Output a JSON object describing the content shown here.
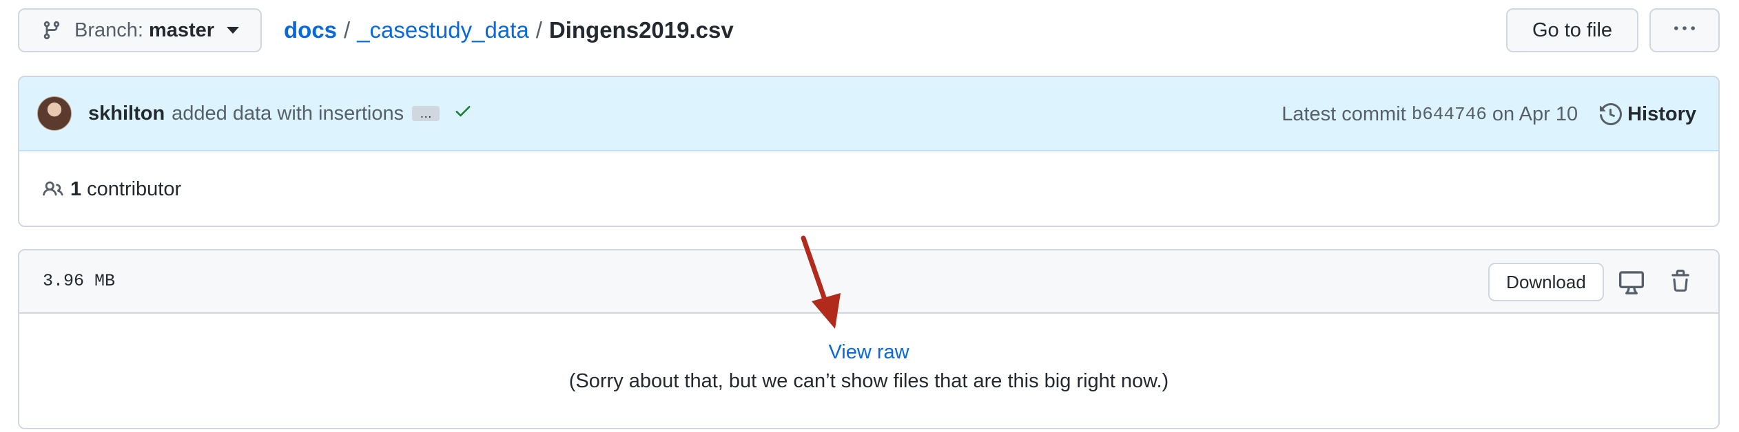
{
  "branch": {
    "label": "Branch:",
    "value": "master"
  },
  "breadcrumb": {
    "root": "docs",
    "sep1": "/",
    "folder": "_casestudy_data",
    "sep2": "/",
    "file": "Dingens2019.csv"
  },
  "header_actions": {
    "goto_file": "Go to file"
  },
  "commit": {
    "author": "skhilton",
    "message": "added data with insertions",
    "ellipsis": "…",
    "latest_label": "Latest commit",
    "sha": "b644746",
    "date": "on Apr 10",
    "history_label": "History"
  },
  "contributors": {
    "count": "1",
    "label": "contributor"
  },
  "file": {
    "size": "3.96 MB",
    "download_label": "Download",
    "view_raw": "View raw",
    "too_big_message": "(Sorry about that, but we can’t show files that are this big right now.)"
  },
  "colors": {
    "link": "#0969da",
    "commit_bg": "#ddf4ff",
    "success": "#1a7f37",
    "annotation_arrow": "#b22a1b"
  }
}
